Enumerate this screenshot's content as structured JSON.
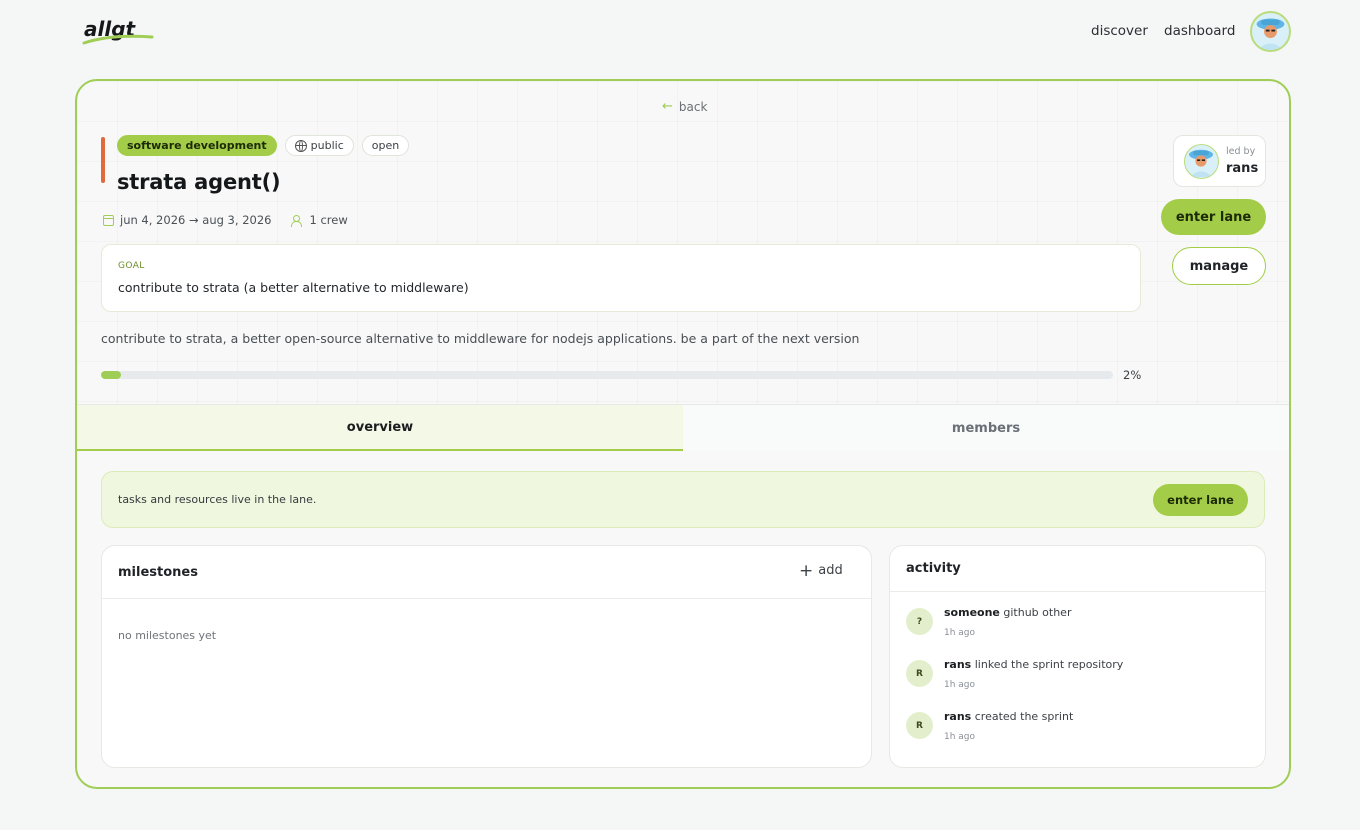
{
  "app": {
    "logo_text": "allgt"
  },
  "nav": {
    "discover": "discover",
    "dashboard": "dashboard"
  },
  "lane": {
    "back": "back",
    "tags": [
      "software development",
      "public",
      "open"
    ],
    "title": "strata agent()",
    "dates": "jun 4, 2026 → aug 3, 2026",
    "crew": "1 crew",
    "goal_label": "GOAL",
    "goal_text": "contribute to strata (a better alternative to middleware)",
    "description": "contribute to strata, a better open-source alternative to middleware for nodejs applications. be a part of the next version",
    "progress_percent": 2,
    "progress_label": "2%",
    "led_by_label": "led by",
    "leader": "rans",
    "enter_lane": "enter lane",
    "manage": "manage"
  },
  "tabs": [
    {
      "label": "overview",
      "active": true
    },
    {
      "label": "members",
      "active": false
    }
  ],
  "banner": {
    "text": "tasks and resources live in the lane.",
    "button": "enter lane"
  },
  "milestones": {
    "title": "milestones",
    "add": "add",
    "empty": "no milestones yet"
  },
  "activity": {
    "title": "activity",
    "items": [
      {
        "initial": "?",
        "actor": "someone",
        "action": "github other",
        "time": "1h ago"
      },
      {
        "initial": "R",
        "actor": "rans",
        "action": "linked the sprint repository",
        "time": "1h ago"
      },
      {
        "initial": "R",
        "actor": "rans",
        "action": "created the sprint",
        "time": "1h ago"
      }
    ]
  },
  "colors": {
    "accent": "#a3cd48",
    "border": "#9fcd55",
    "bar": "#e06a3c"
  }
}
